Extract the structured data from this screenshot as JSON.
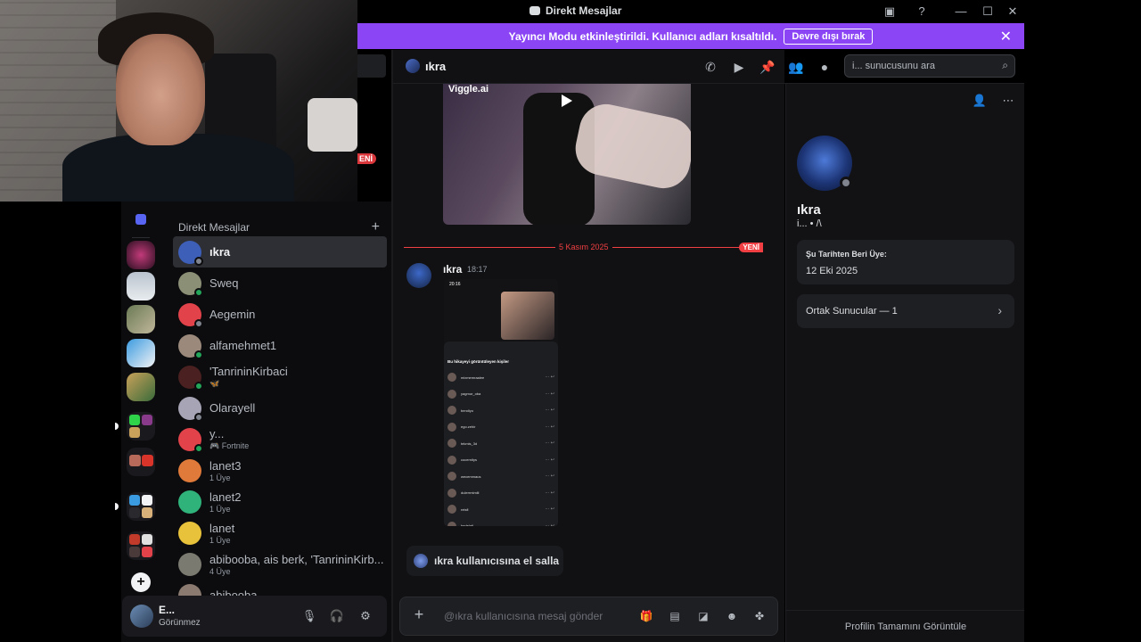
{
  "window": {
    "title": "Direkt Mesajlar",
    "controls": [
      "minimize",
      "maximize",
      "close"
    ]
  },
  "streamer_banner": {
    "text": "Yayıncı Modu etkinleştirildi. Kullanıcı adları kısaltıldı.",
    "button": "Devre dışı bırak"
  },
  "left_new_badge": "ENİ",
  "dm_sidebar": {
    "header": "Direkt Mesajlar",
    "items": [
      {
        "name": "ıkra",
        "sub": "",
        "status": "offline",
        "color": "#3d5fb8",
        "active": true
      },
      {
        "name": "Sweq",
        "sub": "",
        "status": "online",
        "color": "#8a8f76"
      },
      {
        "name": "Aegemin",
        "sub": "",
        "status": "offline",
        "color": "#e2434a"
      },
      {
        "name": "alfamehmet1",
        "sub": "",
        "status": "online",
        "color": "#9b8a7b"
      },
      {
        "name": "'TanrininKirbaci",
        "sub": "🦋",
        "status": "online",
        "color": "#4a2020"
      },
      {
        "name": "Olarayell",
        "sub": "",
        "status": "offline",
        "color": "#a7a4b5"
      },
      {
        "name": "y...",
        "sub": "🎮 Fortnite",
        "status": "online",
        "color": "#e2434a"
      },
      {
        "name": "lanet3",
        "sub": "1 Üye",
        "status": "",
        "color": "#e07a3a"
      },
      {
        "name": "lanet2",
        "sub": "1 Üye",
        "status": "",
        "color": "#2fb37a"
      },
      {
        "name": "lanet",
        "sub": "1 Üye",
        "status": "",
        "color": "#e8c23a"
      },
      {
        "name": "abibooba, ais berk, 'TanrininKirb...",
        "sub": "4 Üye",
        "status": "",
        "color": "#7b7a70"
      },
      {
        "name": "abibooba",
        "sub": "",
        "status": "",
        "color": "#8a7a70"
      }
    ]
  },
  "user_panel": {
    "name": "E...",
    "status": "Görünmez"
  },
  "chat": {
    "recipient": "ıkra",
    "search_placeholder": "i... sunucusunu ara",
    "video_logo": "Viggle.ai",
    "date_separator": "5 Kasım 2025",
    "new_badge": "YENİ",
    "message": {
      "author": "ıkra",
      "time": "18:17"
    },
    "wave_text": "ıkra kullanıcısına el salla",
    "composer_placeholder": "@ıkra kullanıcısına mesaj gönder"
  },
  "screenshot_in_message": {
    "status_time": "20:16",
    "title": "Bu hikayeyi görüntüleyen kişiler",
    "viewers": [
      "mixmemraalee",
      "yagmur_oba",
      "bendiyo",
      "ego.zehir",
      "tekmis_3d",
      "cocernitys",
      "wecemmaus",
      "dulerrmimlii",
      "reisfl",
      "bedelatl"
    ]
  },
  "profile": {
    "name": "ıkra",
    "tag": "i... • /\\",
    "member_since_label": "Şu Tarihten Beri Üye:",
    "member_since": "12 Eki 2025",
    "mutual_servers": "Ortak Sunucular — 1",
    "footer": "Profilin Tamamını Görüntüle"
  },
  "icons": {
    "call": "phone-icon",
    "video": "video-icon",
    "pin": "pin-icon",
    "add_friend": "add-friend-icon",
    "profile_toggle": "user-profile-icon",
    "mic": "mic-icon",
    "headphones": "headphones-icon",
    "settings": "gear-icon",
    "gift": "gift-icon",
    "gif": "gif-icon",
    "sticker": "sticker-icon",
    "emoji": "emoji-icon",
    "apps": "apps-icon"
  }
}
